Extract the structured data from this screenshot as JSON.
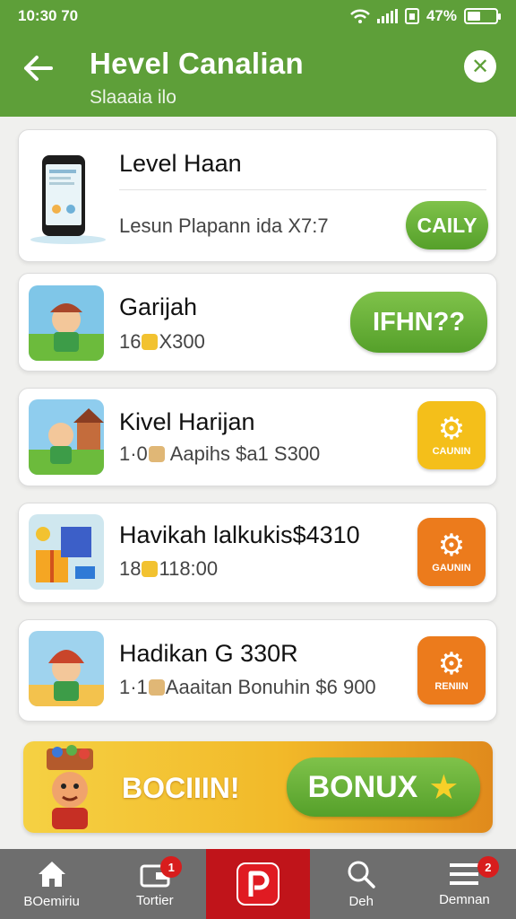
{
  "status_bar": {
    "time": "10:30 70",
    "battery": "47%",
    "battery_level": 0.47
  },
  "header": {
    "title": "Hevel Canalian",
    "subtitle": "Slaaaia ilo"
  },
  "cards": [
    {
      "title": "Level Haan",
      "subtitle": "Lesun Plapann ida X7:7",
      "action": "CAILY",
      "action_style": "pill"
    },
    {
      "title": "Garijah",
      "subtitle_prefix": "16",
      "subtitle_suffix": "X300",
      "action": "IFHN??",
      "action_style": "pill"
    },
    {
      "title": "Kivel Harijan",
      "subtitle_prefix": "1·0",
      "subtitle_suffix": "Aapihs $a1 S300",
      "action": "CAUNIN",
      "action_style": "square",
      "action_color": "#f4bf1a"
    },
    {
      "title": "Havikah lalkukis$4310",
      "subtitle_prefix": "18",
      "subtitle_suffix": "118:00",
      "action": "GAUNIN",
      "action_style": "square",
      "action_color": "#ec7b1c"
    },
    {
      "title": "Hadikan G 330R",
      "subtitle_prefix": "1·1",
      "subtitle_suffix": "Aaaitan Bonuhin $6 900",
      "action": "RENIIN",
      "action_style": "square",
      "action_color": "#ec7b1c"
    }
  ],
  "banner": {
    "text": "BOCIIIN!",
    "button": "BONUX"
  },
  "nav": [
    {
      "label": "BOemiriu",
      "icon": "home-icon",
      "badge": ""
    },
    {
      "label": "Tortier",
      "icon": "wallet-icon",
      "badge": "1"
    },
    {
      "label": "",
      "icon": "p-logo-icon",
      "badge": ""
    },
    {
      "label": "Deh",
      "icon": "search-icon",
      "badge": ""
    },
    {
      "label": "Demnan",
      "icon": "menu-icon",
      "badge": "2"
    }
  ],
  "colors": {
    "header": "#5e9f39",
    "active_nav": "#c0141a",
    "nav_bg": "#6e6e6e"
  }
}
